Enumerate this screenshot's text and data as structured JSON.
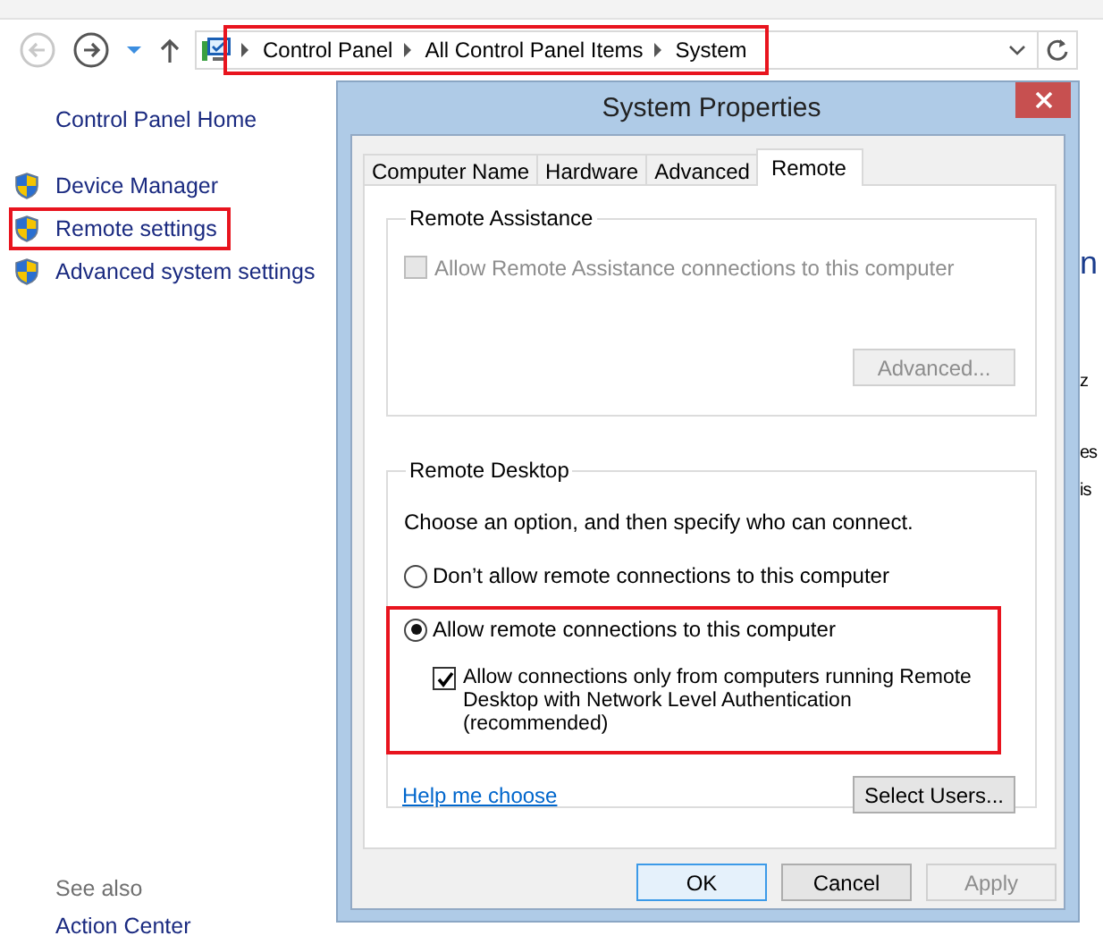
{
  "address_bar": {
    "breadcrumbs": [
      "Control Panel",
      "All Control Panel Items",
      "System"
    ],
    "highlighted": true
  },
  "sidebar": {
    "home_link": "Control Panel Home",
    "items": [
      {
        "label": "Device Manager",
        "highlighted": false
      },
      {
        "label": "Remote settings",
        "highlighted": true
      },
      {
        "label": "Advanced system settings",
        "highlighted": false
      }
    ],
    "see_also": {
      "heading": "See also",
      "links": [
        "Action Center"
      ]
    }
  },
  "background_fragments": [
    {
      "text": "n",
      "kind": "heading"
    },
    {
      "text": "z",
      "kind": "text"
    },
    {
      "text": "es",
      "kind": "text"
    },
    {
      "text": "is",
      "kind": "text"
    }
  ],
  "dialog": {
    "title": "System Properties",
    "tabs": [
      {
        "label": "Computer Name",
        "selected": false
      },
      {
        "label": "Hardware",
        "selected": false
      },
      {
        "label": "Advanced",
        "selected": false
      },
      {
        "label": "Remote",
        "selected": true
      }
    ],
    "remote_assistance": {
      "title": "Remote Assistance",
      "checkbox": {
        "label": "Allow Remote Assistance connections to this computer",
        "checked": false,
        "disabled": true
      },
      "advanced_button": {
        "label": "Advanced...",
        "disabled": true
      }
    },
    "remote_desktop": {
      "title": "Remote Desktop",
      "instruction": "Choose an option, and then specify who can connect.",
      "options": [
        {
          "label": "Don’t allow remote connections to this computer",
          "selected": false,
          "highlighted": false
        },
        {
          "label": "Allow remote connections to this computer",
          "selected": true,
          "highlighted": true,
          "sub_checkbox": {
            "label": "Allow connections only from computers running Remote Desktop with Network Level Authentication (recommended)",
            "checked": true
          }
        }
      ],
      "help_link": "Help me choose",
      "select_users_button": "Select Users..."
    },
    "buttons": [
      {
        "label": "OK",
        "default": true,
        "disabled": false
      },
      {
        "label": "Cancel",
        "default": false,
        "disabled": false
      },
      {
        "label": "Apply",
        "default": false,
        "disabled": true
      }
    ]
  }
}
